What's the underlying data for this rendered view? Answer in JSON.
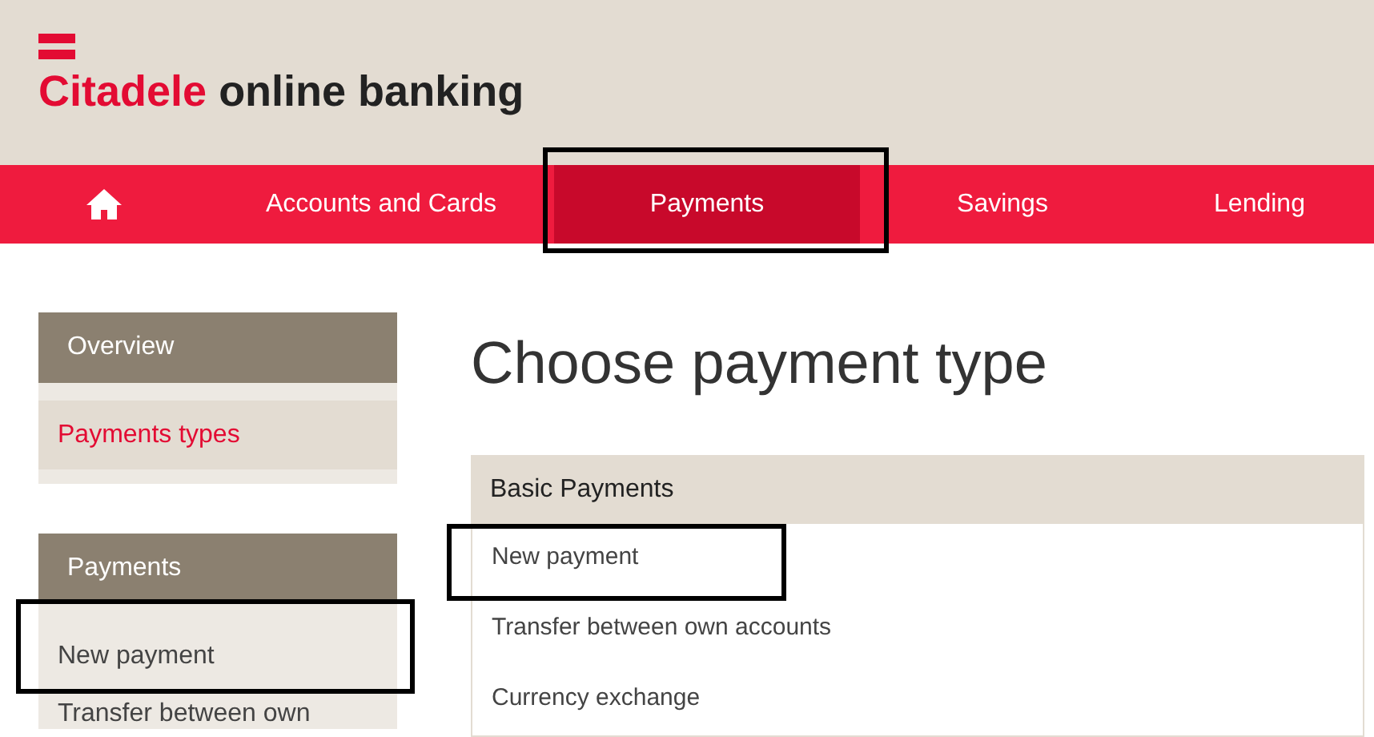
{
  "header": {
    "logo_brand": "Citadele",
    "logo_text": "online banking"
  },
  "nav": [
    {
      "kind": "home",
      "selected": false,
      "highlighted": false
    },
    {
      "kind": "text",
      "label": "Accounts and Cards",
      "selected": false,
      "highlighted": false
    },
    {
      "kind": "text",
      "label": "Payments",
      "selected": true,
      "highlighted": true
    },
    {
      "kind": "text",
      "label": "Savings",
      "selected": false,
      "highlighted": false
    },
    {
      "kind": "text",
      "label": "Lending",
      "selected": false,
      "highlighted": false
    }
  ],
  "sidebar": [
    {
      "title": "Overview",
      "items": [
        {
          "label": "Payments types",
          "selected": true,
          "highlighted": false
        }
      ]
    },
    {
      "title": "Payments",
      "items": [
        {
          "label": "New payment",
          "selected": false,
          "highlighted": true
        },
        {
          "label": "Transfer between own",
          "selected": false,
          "highlighted": false
        }
      ]
    }
  ],
  "main": {
    "heading": "Choose payment type",
    "card": {
      "title": "Basic Payments",
      "items": [
        {
          "label": "New payment",
          "highlighted": true
        },
        {
          "label": "Transfer between own accounts",
          "highlighted": false
        },
        {
          "label": "Currency exchange",
          "highlighted": false
        }
      ]
    }
  }
}
